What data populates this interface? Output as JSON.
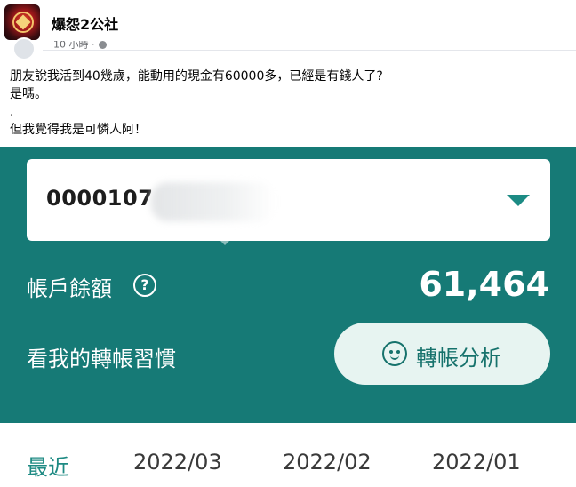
{
  "post": {
    "group_name": "爆怨2公社",
    "meta": "10 小時 ·",
    "lines": [
      "朋友說我活到40幾歲，能動用的現金有60000多，已經是有錢人了?",
      "是嗎。",
      ".",
      "但我覺得我是可憐人阿！"
    ]
  },
  "bank": {
    "account_number": "0000107",
    "balance_label": "帳戶餘額",
    "help_symbol": "?",
    "balance": "61,464",
    "habit_label": "看我的轉帳習慣",
    "analysis_button": "轉帳分析",
    "accent_color": "#167a76",
    "button_bg": "#e7f4f1"
  },
  "tabs": [
    {
      "label": "最近",
      "active": true
    },
    {
      "label": "2022/03",
      "active": false
    },
    {
      "label": "2022/02",
      "active": false
    },
    {
      "label": "2022/01",
      "active": false
    }
  ],
  "icons": {
    "group_avatar": "group-avatar",
    "globe": "globe-icon",
    "dropdown": "chevron-down-icon",
    "help": "help-circle-icon",
    "analysis": "smiley-icon"
  }
}
